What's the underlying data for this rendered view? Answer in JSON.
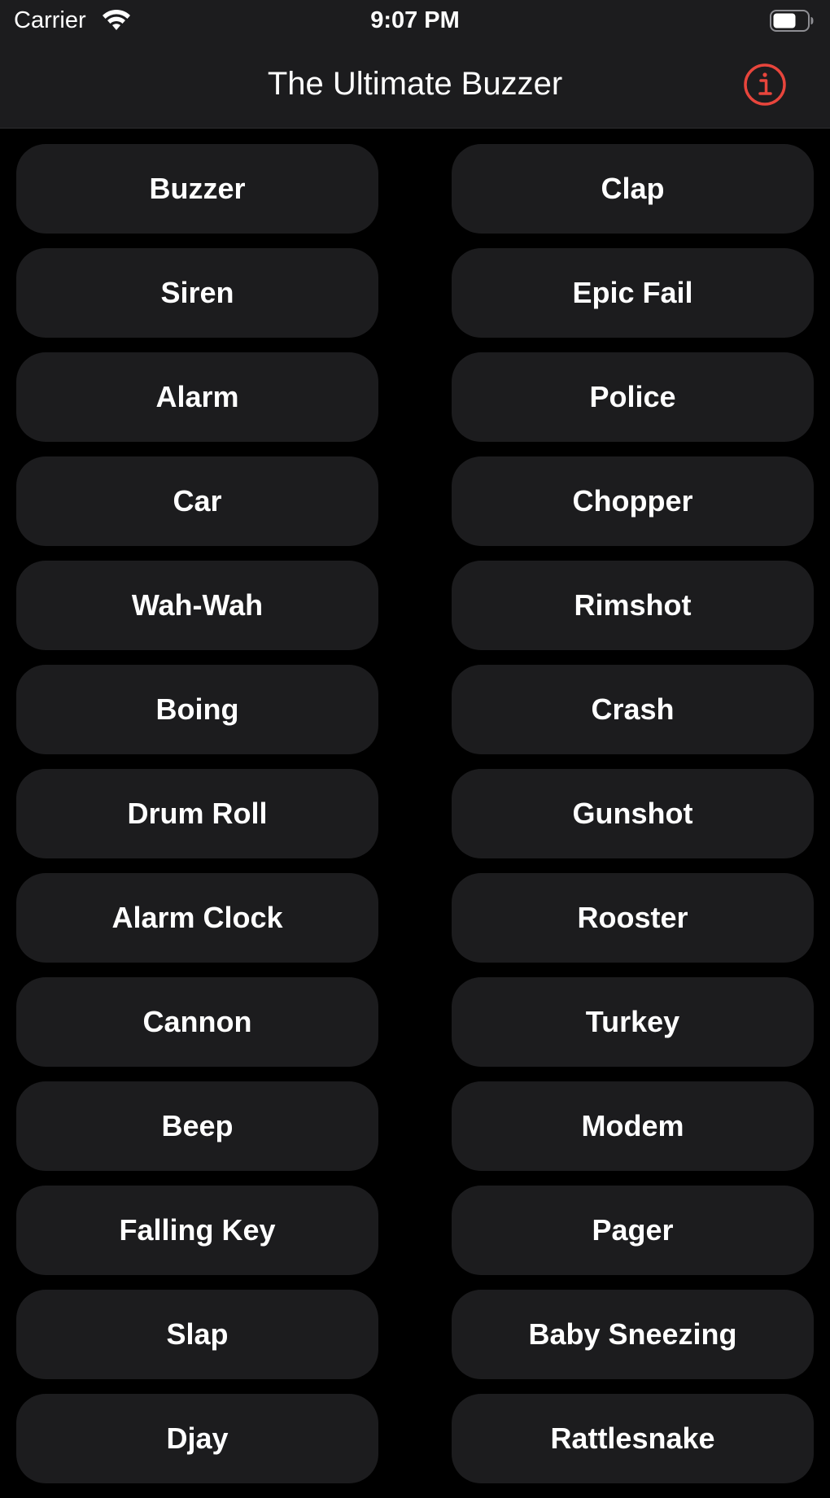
{
  "status_bar": {
    "carrier": "Carrier",
    "time": "9:07 PM",
    "wifi_icon": "wifi-icon",
    "battery_icon": "battery-icon"
  },
  "nav": {
    "title": "The Ultimate Buzzer",
    "info_icon": "info-icon",
    "accent_color": "#e8453c"
  },
  "sounds": [
    [
      "Buzzer",
      "Clap"
    ],
    [
      "Siren",
      "Epic Fail"
    ],
    [
      "Alarm",
      "Police"
    ],
    [
      "Car",
      "Chopper"
    ],
    [
      "Wah-Wah",
      "Rimshot"
    ],
    [
      "Boing",
      "Crash"
    ],
    [
      "Drum Roll",
      "Gunshot"
    ],
    [
      "Alarm Clock",
      "Rooster"
    ],
    [
      "Cannon",
      "Turkey"
    ],
    [
      "Beep",
      "Modem"
    ],
    [
      "Falling Key",
      "Pager"
    ],
    [
      "Slap",
      "Baby Sneezing"
    ],
    [
      "Djay",
      "Rattlesnake"
    ]
  ],
  "colors": {
    "background": "#000000",
    "button": "#1c1c1e",
    "text": "#ffffff"
  }
}
